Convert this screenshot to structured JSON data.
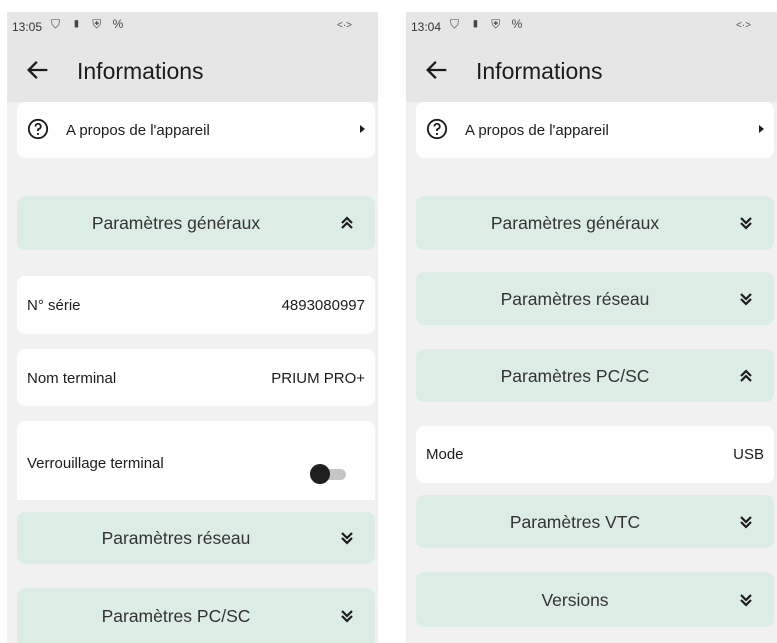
{
  "screens": {
    "left": {
      "status_time": "13:05",
      "title": "Informations",
      "about_label": "A propos de l'appareil",
      "general_section": "Paramètres généraux",
      "serial_label": "N° série",
      "serial_value": "4893080997",
      "terminal_name_label": "Nom terminal",
      "terminal_name_value": "PRIUM PRO+",
      "lock_label": "Verrouillage terminal",
      "lock_enabled": false,
      "network_section": "Paramètres réseau",
      "pcsc_section": "Paramètres PC/SC"
    },
    "right": {
      "status_time": "13:04",
      "title": "Informations",
      "about_label": "A propos de l'appareil",
      "general_section": "Paramètres généraux",
      "network_section": "Paramètres réseau",
      "pcsc_section": "Paramètres PC/SC",
      "mode_label": "Mode",
      "mode_value": "USB",
      "vtc_section": "Paramètres VTC",
      "versions_section": "Versions"
    }
  },
  "status_icons": "⛉ ▮ ⛨ %",
  "status_right": "<·>",
  "colors": {
    "section_bg": "#dcede6",
    "card_bg": "#ffffff",
    "bar_bg": "#e6e6e6",
    "screen_bg": "#f1f1f1"
  },
  "icons": [
    "arrow-back-icon",
    "help-circle-icon",
    "arrow-right-icon",
    "chevron-double-up-icon",
    "chevron-double-down-icon"
  ]
}
